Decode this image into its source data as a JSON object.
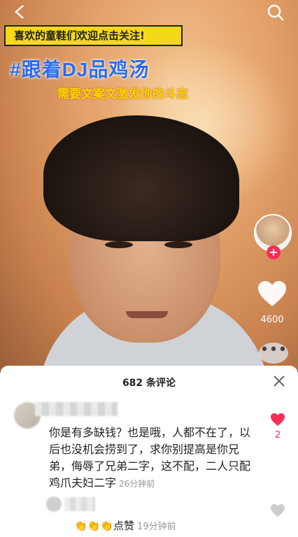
{
  "video": {
    "banner_text": "喜欢的童鞋们欢迎点击关注!",
    "headline": "#跟着DJ品鸡汤",
    "subline": "需要文案文激发你的斗志",
    "like_count": "4600"
  },
  "icons": {
    "back": "chevron-left-icon",
    "search": "search-icon",
    "like": "heart-icon",
    "more": "more-dots-icon",
    "close": "close-icon"
  },
  "comments": {
    "title": "682 条评论",
    "items": [
      {
        "text": "你是有多缺钱？也是哦，人都不在了，以后也没机会捞到了，求你别提高是你兄弟，侮辱了兄弟二字，这不配，二人只配鸡爪夫妇二字",
        "time": "26分钟前",
        "like_count": "2"
      }
    ],
    "reply": {
      "emoji": "👏👏👏",
      "text": "点赞",
      "time": "19分钟前"
    }
  },
  "colors": {
    "accent": "#fe2c55",
    "headline": "#2a6cf0",
    "banner": "#f5d81a",
    "subline": "#ffd400"
  }
}
